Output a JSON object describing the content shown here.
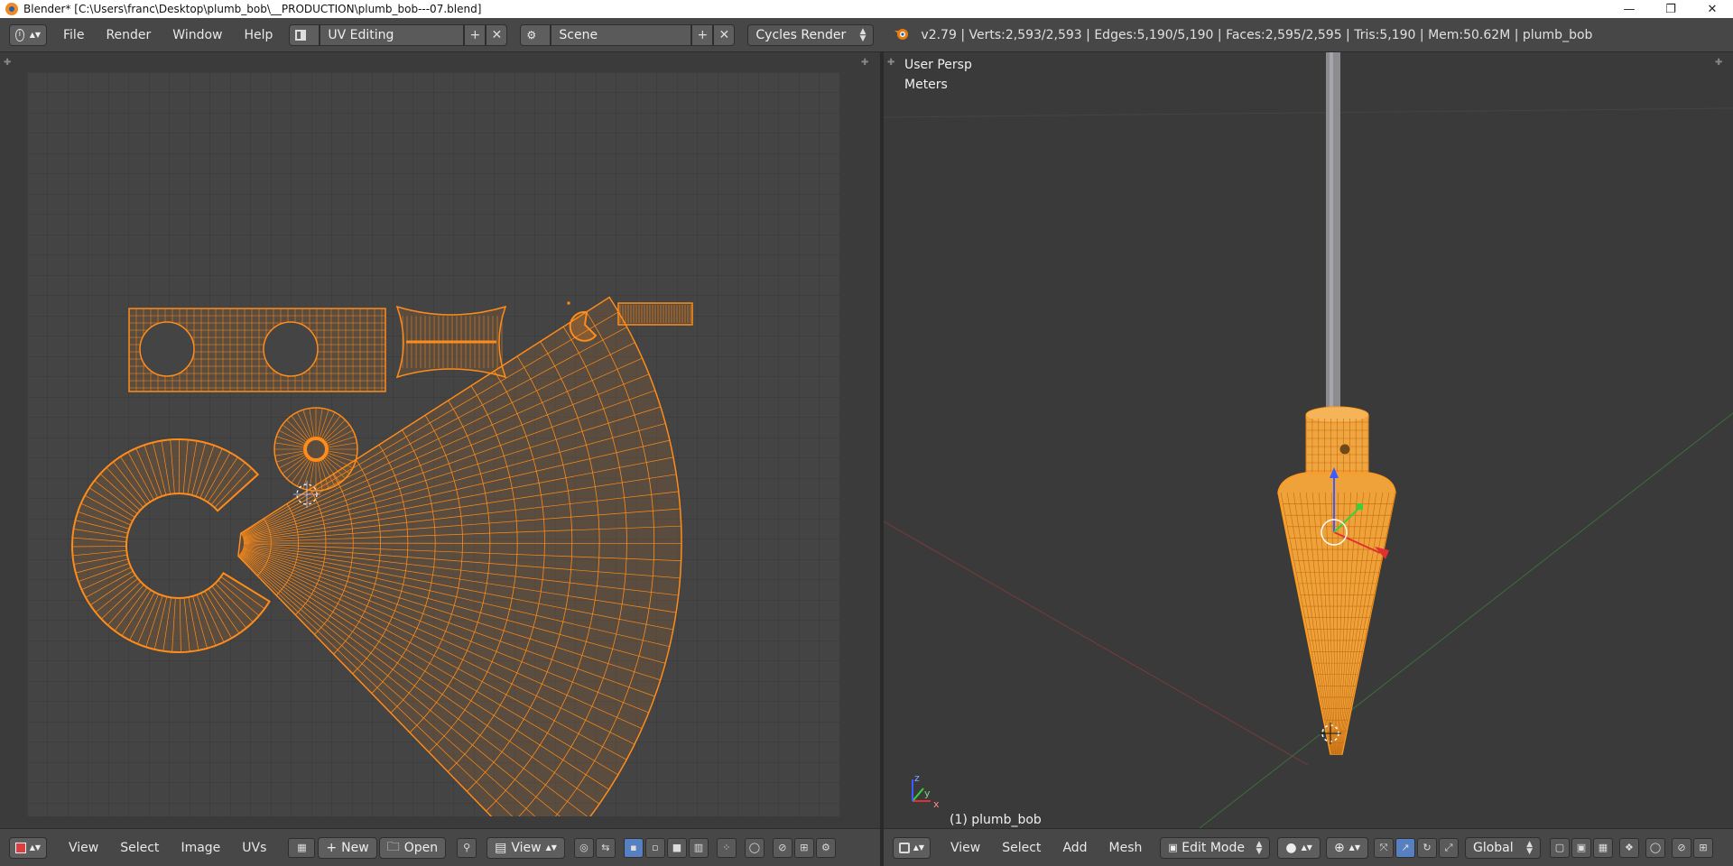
{
  "window": {
    "title": "Blender* [C:\\Users\\franc\\Desktop\\plumb_bob\\__PRODUCTION\\plumb_bob---07.blend]",
    "minimize": "—",
    "maximize": "❐",
    "close": "✕"
  },
  "header": {
    "menus": [
      "File",
      "Render",
      "Window",
      "Help"
    ],
    "layout": "UV Editing",
    "scene": "Scene",
    "engine": "Cycles Render",
    "stats": "v2.79 | Verts:2,593/2,593 | Edges:5,190/5,190 | Faces:2,595/2,595 | Tris:5,190 | Mem:50.62M | plumb_bob"
  },
  "viewport": {
    "view_name": "User Persp",
    "units": "Meters",
    "object_label": "(1) plumb_bob",
    "axis_labels": {
      "x": "x",
      "y": "y",
      "z": "z"
    }
  },
  "uv_footer": {
    "menus": [
      "View",
      "Select",
      "Image",
      "UVs"
    ],
    "new_label": "New",
    "open_label": "Open",
    "view_label": "View"
  },
  "vp_footer": {
    "menus": [
      "View",
      "Select",
      "Add",
      "Mesh"
    ],
    "mode": "Edit Mode",
    "orientation": "Global"
  },
  "colors": {
    "accent_orange": "#ff8c1a",
    "active_blue": "#5680c2",
    "background": "#3d3d3d"
  },
  "icons": {
    "info": "info-icon",
    "layout": "screen-layout-icon",
    "scene": "scene-icon",
    "add": "plus-icon",
    "remove": "close-icon",
    "blender": "blender-logo-icon"
  }
}
